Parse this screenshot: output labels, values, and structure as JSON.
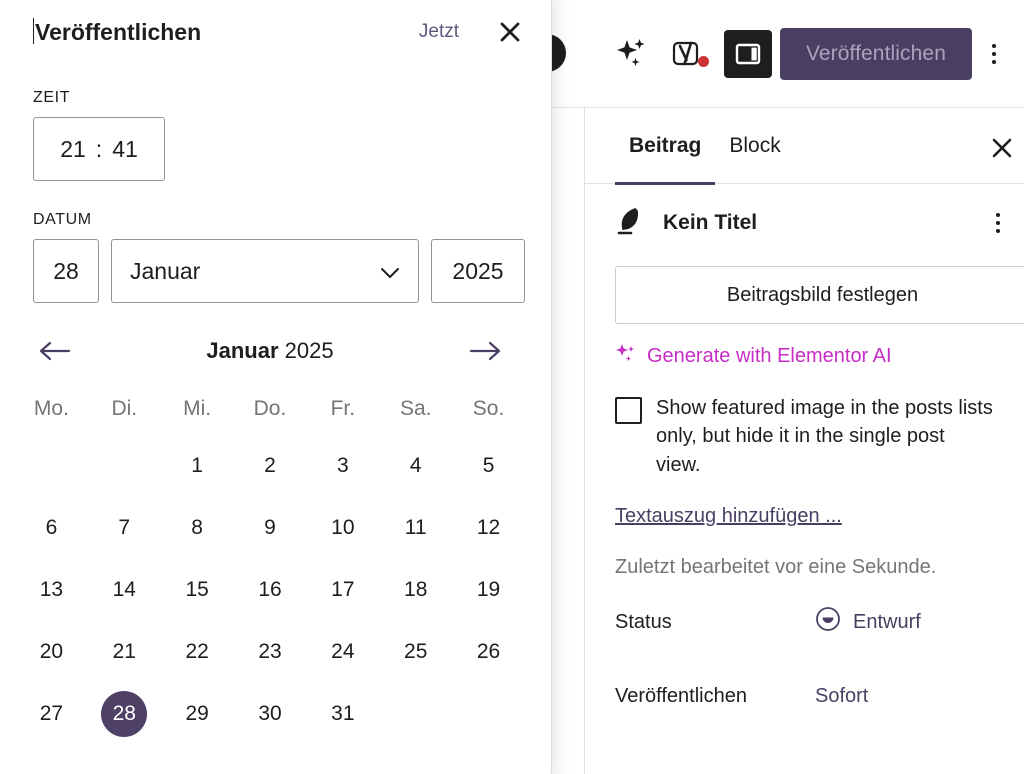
{
  "toolbar": {
    "icons": [
      {
        "name": "elementor-ai-sparkle-icon",
        "label": "Elementor AI"
      },
      {
        "name": "yoast-seo-icon",
        "label": "Yoast SEO"
      }
    ],
    "sidebar_toggle_label": "Einstellungen",
    "publish_label": "Veröffentlichen",
    "options_label": "Optionen"
  },
  "settings_panel": {
    "tabs": [
      {
        "label": "Beitrag",
        "active": true
      },
      {
        "label": "Block",
        "active": false
      }
    ],
    "close_label": "Schließen",
    "post": {
      "icon": "post-feather-icon",
      "title": "Kein Titel",
      "actions_label": "Aktionen"
    },
    "featured_image_button": "Beitragsbild festlegen",
    "elementor_ai_link": "Generate with Elementor AI",
    "checkbox": {
      "checked": false,
      "label": "Show featured image in the posts lists only, but hide it in the single post view."
    },
    "excerpt_link": "Textauszug hinzufügen ...",
    "last_edited": "Zuletzt bearbeitet vor eine Sekunde.",
    "rows": [
      {
        "key": "Status",
        "value": "Entwurf",
        "icon": "draft-status-icon"
      },
      {
        "key": "Veröffentlichen",
        "value": "Sofort",
        "icon": ""
      }
    ]
  },
  "popover": {
    "title": "Veröffentlichen",
    "now_label": "Jetzt",
    "close_label": "Schließen",
    "time_label": "ZEIT",
    "time": {
      "hours": "21",
      "separator": ":",
      "minutes": "41"
    },
    "date_label": "DATUM",
    "date": {
      "day": "28",
      "month": "Januar",
      "year": "2025"
    },
    "calendar": {
      "prev_label": "Vorheriger Monat",
      "next_label": "Nächster Monat",
      "month_name": "Januar",
      "year": "2025",
      "weekdays": [
        "Mo.",
        "Di.",
        "Mi.",
        "Do.",
        "Fr.",
        "Sa.",
        "So."
      ],
      "leading_blanks": 2,
      "days": [
        1,
        2,
        3,
        4,
        5,
        6,
        7,
        8,
        9,
        10,
        11,
        12,
        13,
        14,
        15,
        16,
        17,
        18,
        19,
        20,
        21,
        22,
        23,
        24,
        25,
        26,
        27,
        28,
        29,
        30,
        31
      ],
      "selected_day": 28
    }
  },
  "colors": {
    "accent_purple": "#4a3f63",
    "selected_day_bg": "#4f4165",
    "elementor_magenta": "#c62ec6",
    "yoast_dot_red": "#cc3333",
    "muted_text": "#757575",
    "link_purple": "#5d5a7d"
  }
}
